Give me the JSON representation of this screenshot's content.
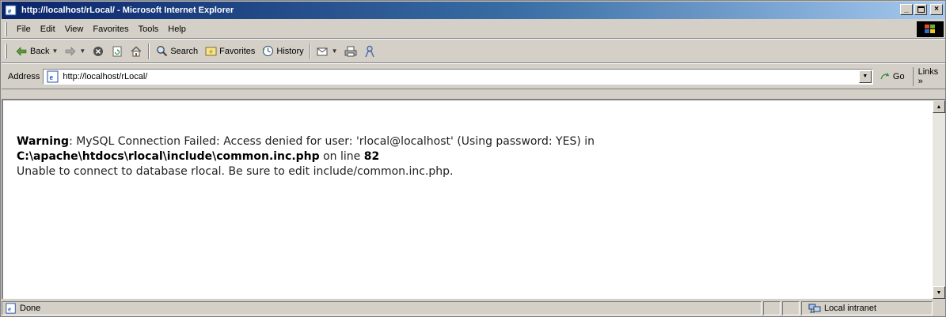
{
  "window": {
    "title": "http://localhost/rLocal/ - Microsoft Internet Explorer",
    "buttons": {
      "minimize": "_",
      "maximize": "▫",
      "close": "×"
    }
  },
  "menubar": {
    "items": [
      "File",
      "Edit",
      "View",
      "Favorites",
      "Tools",
      "Help"
    ]
  },
  "toolbar": {
    "back_label": "Back",
    "search_label": "Search",
    "favorites_label": "Favorites",
    "history_label": "History"
  },
  "addressbar": {
    "label": "Address",
    "url": "http://localhost/rLocal/",
    "go_label": "Go",
    "links_label": "Links »"
  },
  "content": {
    "warning_label": "Warning",
    "warning_text": ": MySQL Connection Failed: Access denied for user: 'rlocal@localhost' (Using password: YES) in",
    "file_path": "C:\\apache\\htdocs\\rlocal\\include\\common.inc.php",
    "line_text": " on line ",
    "line_number": "82",
    "error_message": "Unable to connect to database rlocal. Be sure to edit include/common.inc.php."
  },
  "statusbar": {
    "status_text": "Done",
    "zone_text": "Local intranet"
  },
  "colors": {
    "title_active": "#0a246a",
    "title_gradient_end": "#a6caf0",
    "chrome": "#d4d0c8"
  }
}
